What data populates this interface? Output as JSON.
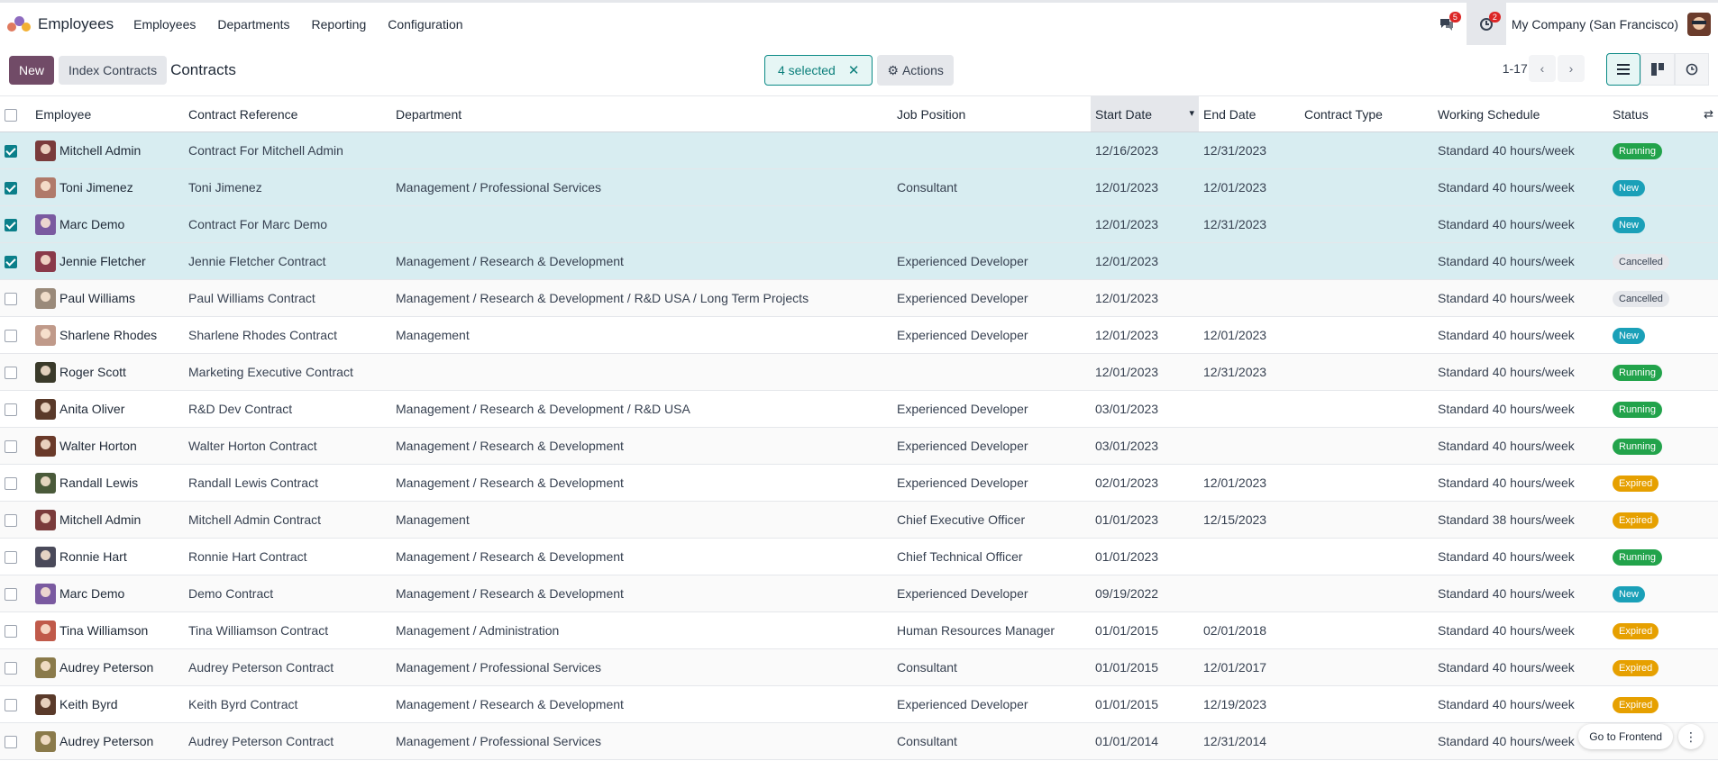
{
  "app": {
    "title": "Employees"
  },
  "menu": [
    "Employees",
    "Departments",
    "Reporting",
    "Configuration"
  ],
  "systray": {
    "messages_count": "5",
    "activities_count": "2",
    "company": "My Company (San Francisco)"
  },
  "control": {
    "new_label": "New",
    "index_label": "Index Contracts",
    "page_title": "Contracts",
    "selected_label": "4 selected",
    "actions_label": "Actions",
    "pager": "1-17 / 17"
  },
  "columns": [
    "Employee",
    "Contract Reference",
    "Department",
    "Job Position",
    "Start Date",
    "End Date",
    "Contract Type",
    "Working Schedule",
    "Status"
  ],
  "rows": [
    {
      "selected": true,
      "employee": "Mitchell Admin",
      "avatar_color": "#7a3b3b",
      "ref": "Contract For Mitchell Admin",
      "department": "",
      "job": "",
      "start": "12/16/2023",
      "end": "12/31/2023",
      "type": "",
      "schedule": "Standard 40 hours/week",
      "status": "Running"
    },
    {
      "selected": true,
      "employee": "Toni Jimenez",
      "avatar_color": "#b07a6a",
      "ref": "Toni Jimenez",
      "department": "Management / Professional Services",
      "job": "Consultant",
      "start": "12/01/2023",
      "end": "12/01/2023",
      "type": "",
      "schedule": "Standard 40 hours/week",
      "status": "New"
    },
    {
      "selected": true,
      "employee": "Marc Demo",
      "avatar_color": "#7a5aa0",
      "ref": "Contract For Marc Demo",
      "department": "",
      "job": "",
      "start": "12/01/2023",
      "end": "12/31/2023",
      "type": "",
      "schedule": "Standard 40 hours/week",
      "status": "New"
    },
    {
      "selected": true,
      "employee": "Jennie Fletcher",
      "avatar_color": "#8a3a4a",
      "ref": "Jennie Fletcher Contract",
      "department": "Management / Research & Development",
      "job": "Experienced Developer",
      "start": "12/01/2023",
      "end": "",
      "type": "",
      "schedule": "Standard 40 hours/week",
      "status": "Cancelled"
    },
    {
      "selected": false,
      "employee": "Paul Williams",
      "avatar_color": "#9a8a7a",
      "ref": "Paul Williams Contract",
      "department": "Management / Research & Development / R&D USA / Long Term Projects",
      "job": "Experienced Developer",
      "start": "12/01/2023",
      "end": "",
      "type": "",
      "schedule": "Standard 40 hours/week",
      "status": "Cancelled"
    },
    {
      "selected": false,
      "employee": "Sharlene Rhodes",
      "avatar_color": "#c09a8a",
      "ref": "Sharlene Rhodes Contract",
      "department": "Management",
      "job": "Experienced Developer",
      "start": "12/01/2023",
      "end": "12/01/2023",
      "type": "",
      "schedule": "Standard 40 hours/week",
      "status": "New"
    },
    {
      "selected": false,
      "employee": "Roger Scott",
      "avatar_color": "#3a3a2a",
      "ref": "Marketing Executive Contract",
      "department": "",
      "job": "",
      "start": "12/01/2023",
      "end": "12/31/2023",
      "type": "",
      "schedule": "Standard 40 hours/week",
      "status": "Running"
    },
    {
      "selected": false,
      "employee": "Anita Oliver",
      "avatar_color": "#5a3a2a",
      "ref": "R&D Dev Contract",
      "department": "Management / Research & Development / R&D USA",
      "job": "Experienced Developer",
      "start": "03/01/2023",
      "end": "",
      "type": "",
      "schedule": "Standard 40 hours/week",
      "status": "Running"
    },
    {
      "selected": false,
      "employee": "Walter Horton",
      "avatar_color": "#6a3a2a",
      "ref": "Walter Horton Contract",
      "department": "Management / Research & Development",
      "job": "Experienced Developer",
      "start": "03/01/2023",
      "end": "",
      "type": "",
      "schedule": "Standard 40 hours/week",
      "status": "Running"
    },
    {
      "selected": false,
      "employee": "Randall Lewis",
      "avatar_color": "#4a5a3a",
      "ref": "Randall Lewis Contract",
      "department": "Management / Research & Development",
      "job": "Experienced Developer",
      "start": "02/01/2023",
      "end": "12/01/2023",
      "type": "",
      "schedule": "Standard 40 hours/week",
      "status": "Expired"
    },
    {
      "selected": false,
      "employee": "Mitchell Admin",
      "avatar_color": "#7a3b3b",
      "ref": "Mitchell Admin Contract",
      "department": "Management",
      "job": "Chief Executive Officer",
      "start": "01/01/2023",
      "end": "12/15/2023",
      "type": "",
      "schedule": "Standard 38 hours/week",
      "status": "Expired"
    },
    {
      "selected": false,
      "employee": "Ronnie Hart",
      "avatar_color": "#4a4a5a",
      "ref": "Ronnie Hart Contract",
      "department": "Management / Research & Development",
      "job": "Chief Technical Officer",
      "start": "01/01/2023",
      "end": "",
      "type": "",
      "schedule": "Standard 40 hours/week",
      "status": "Running"
    },
    {
      "selected": false,
      "employee": "Marc Demo",
      "avatar_color": "#7a5aa0",
      "ref": "Demo Contract",
      "department": "Management / Research & Development",
      "job": "Experienced Developer",
      "start": "09/19/2022",
      "end": "",
      "type": "",
      "schedule": "Standard 40 hours/week",
      "status": "New"
    },
    {
      "selected": false,
      "employee": "Tina Williamson",
      "avatar_color": "#c05a4a",
      "ref": "Tina Williamson Contract",
      "department": "Management / Administration",
      "job": "Human Resources Manager",
      "start": "01/01/2015",
      "end": "02/01/2018",
      "type": "",
      "schedule": "Standard 40 hours/week",
      "status": "Expired"
    },
    {
      "selected": false,
      "employee": "Audrey Peterson",
      "avatar_color": "#8a7a4a",
      "ref": "Audrey Peterson Contract",
      "department": "Management / Professional Services",
      "job": "Consultant",
      "start": "01/01/2015",
      "end": "12/01/2017",
      "type": "",
      "schedule": "Standard 40 hours/week",
      "status": "Expired"
    },
    {
      "selected": false,
      "employee": "Keith Byrd",
      "avatar_color": "#5a3a2a",
      "ref": "Keith Byrd Contract",
      "department": "Management / Research & Development",
      "job": "Experienced Developer",
      "start": "01/01/2015",
      "end": "12/19/2023",
      "type": "",
      "schedule": "Standard 40 hours/week",
      "status": "Expired"
    },
    {
      "selected": false,
      "employee": "Audrey Peterson",
      "avatar_color": "#8a7a4a",
      "ref": "Audrey Peterson Contract",
      "department": "Management / Professional Services",
      "job": "Consultant",
      "start": "01/01/2014",
      "end": "12/31/2014",
      "type": "",
      "schedule": "Standard 40 hours/week",
      "status": ""
    }
  ],
  "floating": {
    "frontend_label": "Go to Frontend"
  },
  "colors": {
    "brand": "#714b67",
    "accent": "#0b8a86",
    "running": "#22a34b",
    "new": "#1aa0b8",
    "expired": "#e6a000"
  }
}
